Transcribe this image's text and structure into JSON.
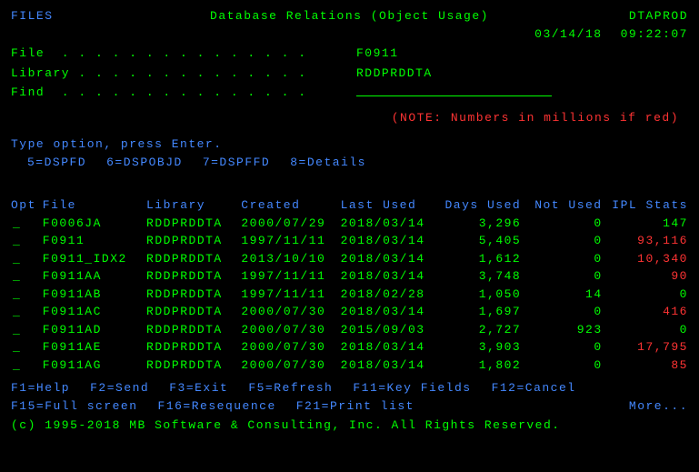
{
  "header": {
    "left": "FILES",
    "title": "Database Relations (Object Usage)",
    "right": "DTAPROD",
    "date": "03/14/18",
    "time": "09:22:07"
  },
  "fields": {
    "file_label": "File  . . . . . . . . . . . . . . .  ",
    "file_value": "F0911",
    "library_label": "Library . . . . . . . . . . . . . .  ",
    "library_value": "RDDPRDDTA",
    "find_label": "Find  . . . . . . . . . . . . . . .  "
  },
  "note": "(NOTE: Numbers in millions if red)",
  "instructions": "Type option, press Enter.",
  "options": {
    "o1": "5=DSPFD",
    "o2": "6=DSPOBJD",
    "o3": "7=DSPFFD",
    "o4": "8=Details"
  },
  "columns": {
    "opt": "Opt",
    "file": "File",
    "library": "Library",
    "created": "Created",
    "lastused": "Last Used",
    "daysused": "Days Used",
    "notused": "Not Used",
    "ipl": "IPL Stats"
  },
  "rows": [
    {
      "file": "F0006JA",
      "library": "RDDPRDDTA",
      "created": "2000/07/29",
      "lastused": "2018/03/14",
      "daysused": "3,296",
      "notused": "0",
      "ipl": "147",
      "ipl_red": false
    },
    {
      "file": "F0911",
      "library": "RDDPRDDTA",
      "created": "1997/11/11",
      "lastused": "2018/03/14",
      "daysused": "5,405",
      "notused": "0",
      "ipl": "93,116",
      "ipl_red": true
    },
    {
      "file": "F0911_IDX2",
      "library": "RDDPRDDTA",
      "created": "2013/10/10",
      "lastused": "2018/03/14",
      "daysused": "1,612",
      "notused": "0",
      "ipl": "10,340",
      "ipl_red": true
    },
    {
      "file": "F0911AA",
      "library": "RDDPRDDTA",
      "created": "1997/11/11",
      "lastused": "2018/03/14",
      "daysused": "3,748",
      "notused": "0",
      "ipl": "90",
      "ipl_red": true
    },
    {
      "file": "F0911AB",
      "library": "RDDPRDDTA",
      "created": "1997/11/11",
      "lastused": "2018/02/28",
      "daysused": "1,050",
      "notused": "14",
      "ipl": "0",
      "ipl_red": false
    },
    {
      "file": "F0911AC",
      "library": "RDDPRDDTA",
      "created": "2000/07/30",
      "lastused": "2018/03/14",
      "daysused": "1,697",
      "notused": "0",
      "ipl": "416",
      "ipl_red": true
    },
    {
      "file": "F0911AD",
      "library": "RDDPRDDTA",
      "created": "2000/07/30",
      "lastused": "2015/09/03",
      "daysused": "2,727",
      "notused": "923",
      "ipl": "0",
      "ipl_red": false
    },
    {
      "file": "F0911AE",
      "library": "RDDPRDDTA",
      "created": "2000/07/30",
      "lastused": "2018/03/14",
      "daysused": "3,903",
      "notused": "0",
      "ipl": "17,795",
      "ipl_red": true
    },
    {
      "file": "F0911AG",
      "library": "RDDPRDDTA",
      "created": "2000/07/30",
      "lastused": "2018/03/14",
      "daysused": "1,802",
      "notused": "0",
      "ipl": "85",
      "ipl_red": true
    }
  ],
  "fkeys": {
    "f1": "F1=Help",
    "f2": "F2=Send",
    "f3": "F3=Exit",
    "f5": "F5=Refresh",
    "f11": "F11=Key Fields",
    "f12": "F12=Cancel",
    "f15": "F15=Full screen",
    "f16": "F16=Resequence",
    "f21": "F21=Print list",
    "more": "More..."
  },
  "copyright": "(c) 1995-2018 MB Software & Consulting, Inc.  All Rights Reserved."
}
